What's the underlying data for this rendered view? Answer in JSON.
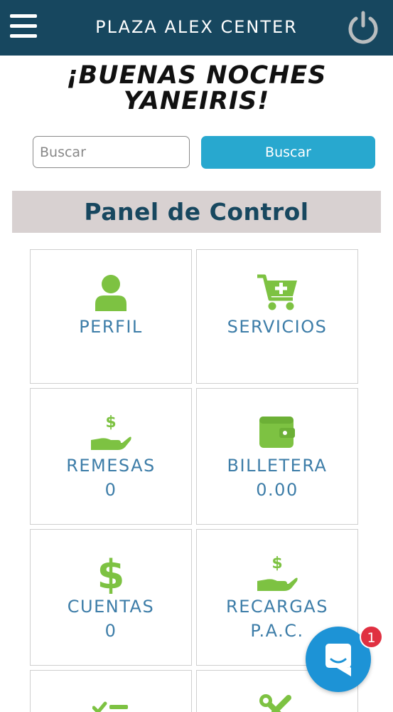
{
  "header": {
    "title": "PLAZA ALEX CENTER",
    "menu_icon": "hamburger-menu-icon",
    "power_icon": "power-icon",
    "background_color": "#17475f"
  },
  "greeting": {
    "line1": "¡BUENAS NOCHES",
    "line2": "YANEIRIS!"
  },
  "search": {
    "placeholder": "Buscar",
    "value": "",
    "button_label": "Buscar",
    "button_color": "#28a8cf"
  },
  "panel": {
    "title": "Panel de Control"
  },
  "cards": [
    {
      "label": "PERFIL",
      "value": "",
      "icon": "user-icon"
    },
    {
      "label": "SERVICIOS",
      "value": "",
      "icon": "cart-plus-icon"
    },
    {
      "label": "REMESAS",
      "value": "0",
      "icon": "hand-dollar-icon"
    },
    {
      "label": "BILLETERA",
      "value": "0.00",
      "icon": "wallet-icon"
    },
    {
      "label": "CUENTAS",
      "value": "0",
      "icon": "dollar-icon"
    },
    {
      "label": "RECARGAS",
      "value": "P.A.C.",
      "icon": "hand-dollar-icon"
    },
    {
      "label": "",
      "value": "",
      "icon": "checklist-icon"
    },
    {
      "label": "",
      "value": "",
      "icon": "tools-icon"
    }
  ],
  "chat": {
    "icon": "chat-icon",
    "badge_count": "1",
    "badge_color": "#e03041"
  },
  "colors": {
    "icon_green": "#7dc242",
    "label_blue": "#3d7da8",
    "panel_bg": "#d8d1d1"
  }
}
